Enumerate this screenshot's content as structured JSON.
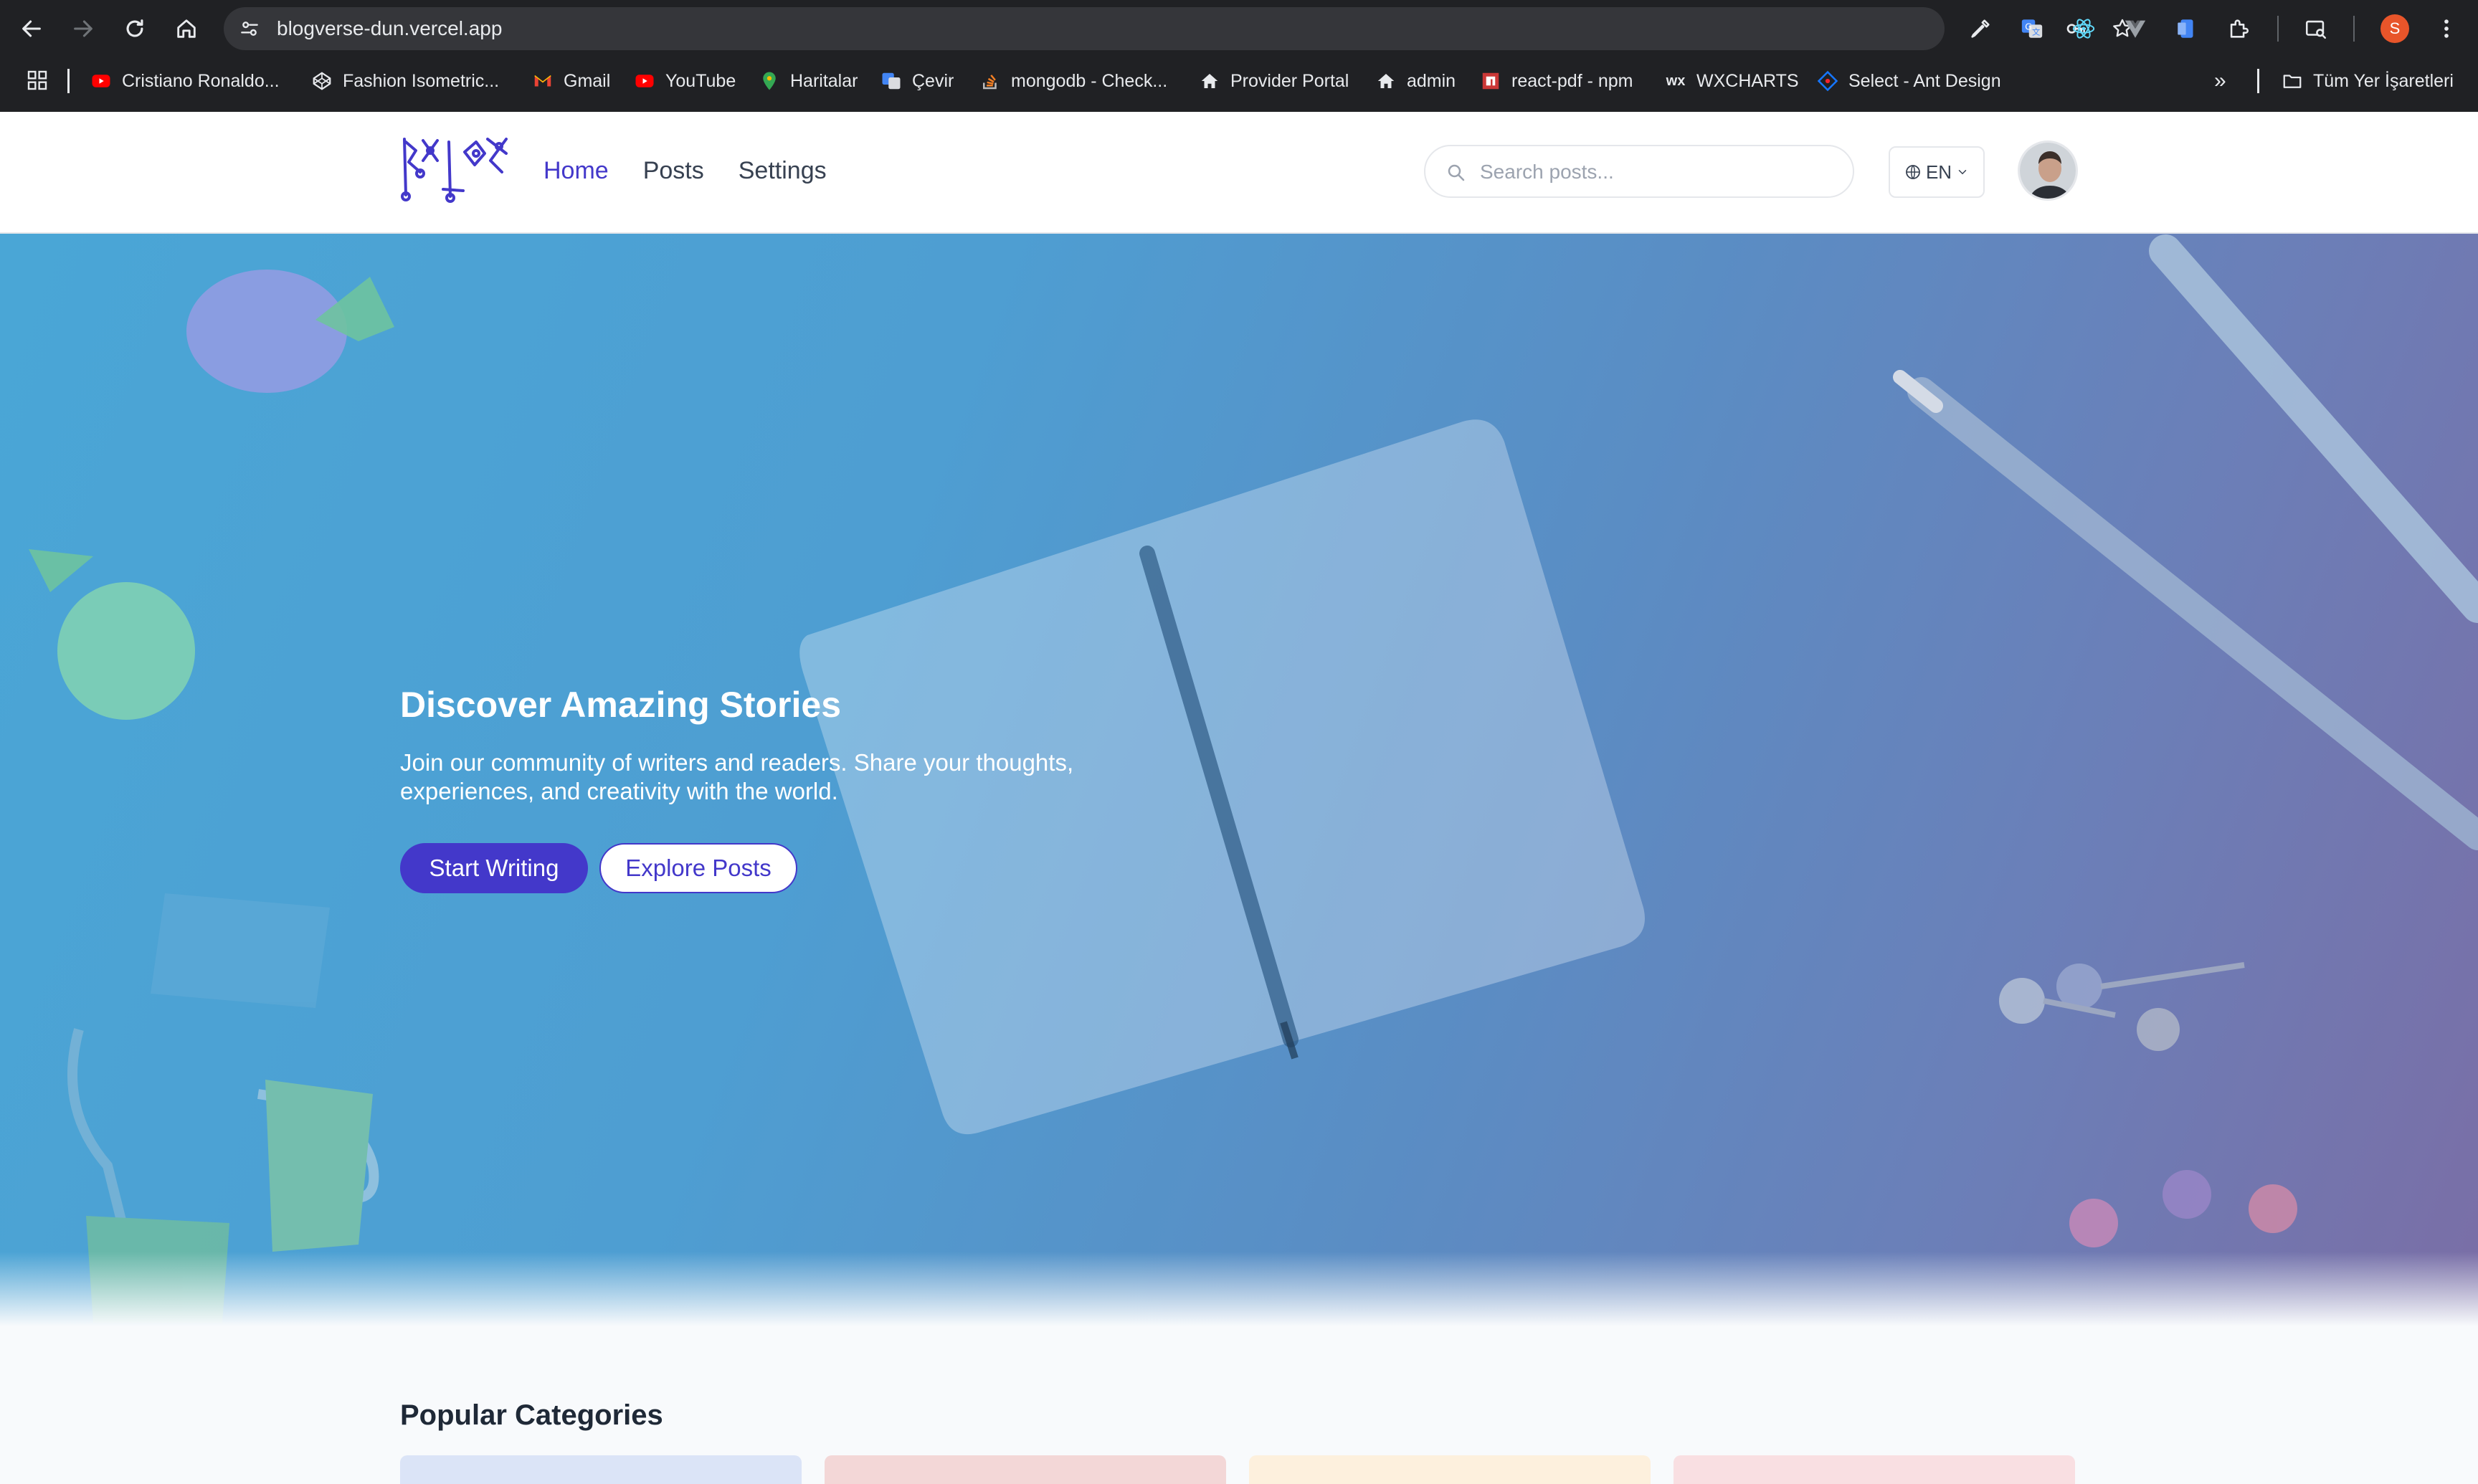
{
  "browser": {
    "url": "blogverse-dun.vercel.app",
    "profile_initial": "S",
    "bookmarks": [
      {
        "label": "Cristiano Ronaldo...",
        "icon": "youtube-icon"
      },
      {
        "label": "Fashion Isometric...",
        "icon": "codepen-icon"
      },
      {
        "label": "Gmail",
        "icon": "gmail-icon"
      },
      {
        "label": "YouTube",
        "icon": "youtube-icon"
      },
      {
        "label": "Haritalar",
        "icon": "maps-icon"
      },
      {
        "label": "Çevir",
        "icon": "translate-icon"
      },
      {
        "label": "mongodb - Check...",
        "icon": "stackoverflow-icon"
      },
      {
        "label": "Provider Portal",
        "icon": "home-icon"
      },
      {
        "label": "admin",
        "icon": "home-icon"
      },
      {
        "label": "react-pdf - npm",
        "icon": "npm-icon"
      },
      {
        "label": "WXCHARTS",
        "icon": "wx-icon"
      },
      {
        "label": "Select - Ant Design",
        "icon": "antdesign-icon"
      }
    ],
    "all_bookmarks_label": "Tüm Yer İşaretleri"
  },
  "header": {
    "nav": [
      {
        "label": "Home",
        "active": true
      },
      {
        "label": "Posts",
        "active": false
      },
      {
        "label": "Settings",
        "active": false
      }
    ],
    "search_placeholder": "Search posts...",
    "language": "EN"
  },
  "hero": {
    "title": "Discover Amazing Stories",
    "subtitle": "Join our community of writers and readers. Share your thoughts, experiences, and creativity with the world.",
    "primary_button": "Start Writing",
    "secondary_button": "Explore Posts"
  },
  "categories": {
    "title": "Popular Categories",
    "card_colors": [
      "#dbe4f7",
      "#f3d7d7",
      "#fdf0dd",
      "#f9dfe2"
    ]
  },
  "colors": {
    "accent": "#4338ca",
    "chrome_bg": "#202124",
    "omnibox_bg": "#35363a"
  }
}
